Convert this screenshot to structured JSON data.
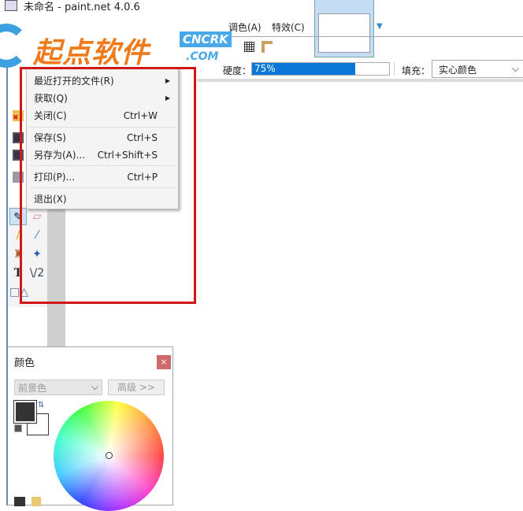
{
  "window": {
    "title": "未命名 - paint.net 4.0.6"
  },
  "watermark": {
    "brand_cn": "起点软件",
    "brand_en": "CNCRK",
    "domain": ".COM"
  },
  "menu_tabs": [
    {
      "label": "调色(A)"
    },
    {
      "label": "特效(C)"
    }
  ],
  "toolbar": {
    "hardness_label": "硬度：",
    "hardness_value": "75%",
    "hardness_percent": 75,
    "fill_label": "填充：",
    "fill_value": "实心颜色"
  },
  "file_menu": {
    "items": [
      {
        "label": "最近打开的文件(R)",
        "shortcut": "",
        "submenu": true
      },
      {
        "label": "获取(Q)",
        "shortcut": "",
        "submenu": true
      },
      {
        "label": "关闭(C)",
        "shortcut": "Ctrl+W"
      },
      {
        "label": "保存(S)",
        "shortcut": "Ctrl+S"
      },
      {
        "label": "另存为(A)...",
        "shortcut": "Ctrl+Shift+S"
      },
      {
        "label": "打印(P)...",
        "shortcut": "Ctrl+P"
      },
      {
        "label": "退出(X)",
        "shortcut": ""
      }
    ]
  },
  "tools": {
    "text_glyph": "T",
    "curve_glyph": "\\/2"
  },
  "colors_panel": {
    "title": "颜色",
    "close": "×",
    "mode": "前景色",
    "advanced": "高级 >>",
    "primary": "#333333",
    "secondary": "#ffffff"
  }
}
